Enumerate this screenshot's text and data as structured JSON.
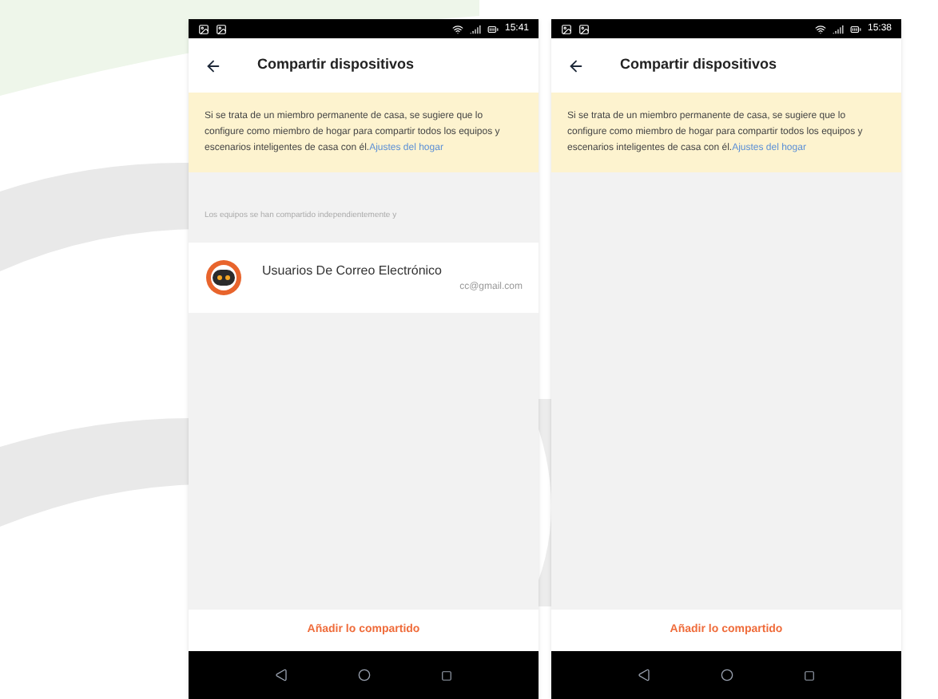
{
  "screens": [
    {
      "status_bar": {
        "time": "15:41"
      },
      "header": {
        "title": "Compartir dispositivos"
      },
      "notice": {
        "text": "Si se trata de un miembro permanente de casa, se sugiere que lo configure como miembro de hogar para compartir todos los equipos y escenarios inteligentes de casa con él.",
        "link": "Ajustes del hogar"
      },
      "section_label": "Los equipos se han compartido independientemente y",
      "users": [
        {
          "name": "Usuarios De Correo Electrónico",
          "email": "cc@gmail.com"
        }
      ],
      "action_button": "Añadir lo compartido"
    },
    {
      "status_bar": {
        "time": "15:38"
      },
      "header": {
        "title": "Compartir dispositivos"
      },
      "notice": {
        "text": "Si se trata de un miembro permanente de casa, se sugiere que lo configure como miembro de hogar para compartir todos los equipos y escenarios inteligentes de casa con él.",
        "link": "Ajustes del hogar"
      },
      "action_button": "Añadir lo compartido"
    }
  ]
}
